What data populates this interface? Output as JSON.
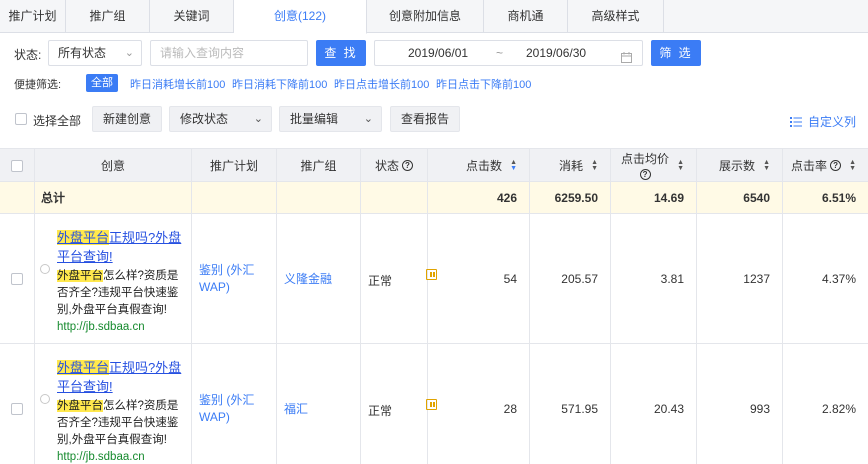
{
  "tabs": [
    {
      "label": "推广计划"
    },
    {
      "label": "推广组"
    },
    {
      "label": "关键词"
    },
    {
      "label": "创意(122)"
    },
    {
      "label": "创意附加信息"
    },
    {
      "label": "商机通"
    },
    {
      "label": "高级样式"
    }
  ],
  "filter": {
    "status_label": "状态:",
    "status_value": "所有状态",
    "search_placeholder": "请输入查询内容",
    "search_button": "查 找",
    "date_start": "2019/06/01",
    "date_sep": "~",
    "date_end": "2019/06/30",
    "filter_button": "筛 选"
  },
  "quick": {
    "label": "便捷筛选:",
    "all": "全部",
    "links": [
      "昨日消耗增长前100",
      "昨日消耗下降前100",
      "昨日点击增长前100",
      "昨日点击下降前100"
    ]
  },
  "actions": {
    "select_all": "选择全部",
    "new_creative": "新建创意",
    "modify_status": "修改状态",
    "batch_edit": "批量编辑",
    "view_report": "查看报告",
    "custom_columns": "自定义列"
  },
  "table": {
    "headers": {
      "creative": "创意",
      "plan": "推广计划",
      "group": "推广组",
      "status": "状态",
      "clicks": "点击数",
      "cost": "消耗",
      "cpc": "点击均价",
      "impressions": "展示数",
      "ctr": "点击率"
    },
    "total": {
      "label": "总计",
      "clicks": "426",
      "cost": "6259.50",
      "cpc": "14.69",
      "impressions": "6540",
      "ctr": "6.51%"
    },
    "rows": [
      {
        "title_hl": "外盘平台",
        "title_rest": "正规吗?外盘平台查询!",
        "desc_hl": "外盘平台",
        "desc_rest": "怎么样?资质是否齐全?违规平台快速鉴别,外盘平台真假查询!",
        "url": "http://jb.sdbaa.cn",
        "plan": "鉴别 (外汇WAP)",
        "group": "义隆金融",
        "status": "正常",
        "clicks": "54",
        "cost": "205.57",
        "cpc": "3.81",
        "impressions": "1237",
        "ctr": "4.37%"
      },
      {
        "title_hl": "外盘平台",
        "title_rest": "正规吗?外盘平台查询!",
        "desc_hl": "外盘平台",
        "desc_rest": "怎么样?资质是否齐全?违规平台快速鉴别,外盘平台真假查询!",
        "url": "http://jb.sdbaa.cn",
        "plan": "鉴别 (外汇WAP)",
        "group": "福汇",
        "status": "正常",
        "clicks": "28",
        "cost": "571.95",
        "cpc": "20.43",
        "impressions": "993",
        "ctr": "2.82%"
      }
    ]
  },
  "colors": {
    "accent": "#3b7cf5",
    "highlight": "#ffe84d",
    "total_bg": "#fffae6",
    "url_green": "#168a2e"
  }
}
